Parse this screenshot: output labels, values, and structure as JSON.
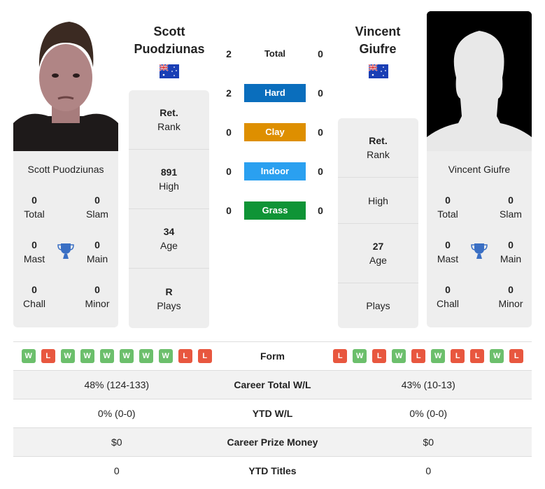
{
  "player1": {
    "name": "Scott Puodziunas",
    "name_line1": "Scott",
    "name_line2": "Puodziunas",
    "country": "Australia",
    "flag_icon": "australia-flag-icon",
    "titles": {
      "total": "0",
      "slam": "0",
      "mast": "0",
      "main": "0",
      "chall": "0",
      "minor": "0"
    },
    "rank": {
      "value": "Ret.",
      "label": "Rank"
    },
    "high": {
      "value": "891",
      "label": "High"
    },
    "age": {
      "value": "34",
      "label": "Age"
    },
    "plays": {
      "value": "R",
      "label": "Plays"
    },
    "form": [
      "W",
      "L",
      "W",
      "W",
      "W",
      "W",
      "W",
      "W",
      "L",
      "L"
    ],
    "career_wl": "48% (124-133)",
    "ytd_wl": "0% (0-0)",
    "prize": "$0",
    "ytd_titles": "0"
  },
  "player2": {
    "name": "Vincent Giufre",
    "name_line1": "Vincent",
    "name_line2": "Giufre",
    "country": "Australia",
    "flag_icon": "australia-flag-icon",
    "titles": {
      "total": "0",
      "slam": "0",
      "mast": "0",
      "main": "0",
      "chall": "0",
      "minor": "0"
    },
    "rank": {
      "value": "Ret.",
      "label": "Rank"
    },
    "high": {
      "value": "",
      "label": "High"
    },
    "age": {
      "value": "27",
      "label": "Age"
    },
    "plays": {
      "value": "",
      "label": "Plays"
    },
    "form": [
      "L",
      "W",
      "L",
      "W",
      "L",
      "W",
      "L",
      "L",
      "W",
      "L"
    ],
    "career_wl": "43% (10-13)",
    "ytd_wl": "0% (0-0)",
    "prize": "$0",
    "ytd_titles": "0"
  },
  "title_labels": {
    "total": "Total",
    "slam": "Slam",
    "mast": "Mast",
    "main": "Main",
    "chall": "Chall",
    "minor": "Minor"
  },
  "h2h": [
    {
      "surface": "Total",
      "p1": "2",
      "p2": "0",
      "color": ""
    },
    {
      "surface": "Hard",
      "p1": "2",
      "p2": "0",
      "color": "#0a6ebd"
    },
    {
      "surface": "Clay",
      "p1": "0",
      "p2": "0",
      "color": "#de8f00"
    },
    {
      "surface": "Indoor",
      "p1": "0",
      "p2": "0",
      "color": "#2aa0f0"
    },
    {
      "surface": "Grass",
      "p1": "0",
      "p2": "0",
      "color": "#0f9436"
    }
  ],
  "stats_labels": {
    "form": "Form",
    "career_wl": "Career Total W/L",
    "ytd_wl": "YTD W/L",
    "prize": "Career Prize Money",
    "ytd_titles": "YTD Titles"
  }
}
